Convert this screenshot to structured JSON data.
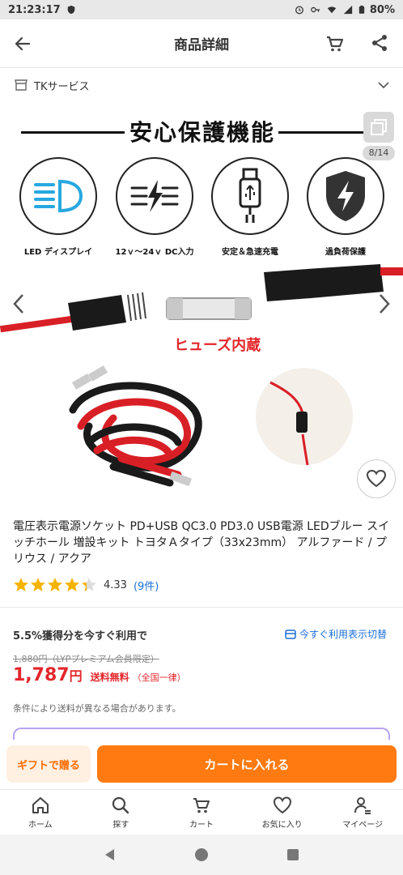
{
  "status": {
    "time": "21:23:17",
    "battery": "80%"
  },
  "header": {
    "title": "商品詳細"
  },
  "store": {
    "name": "TKサービス"
  },
  "gallery": {
    "heading": "安心保護機能",
    "features": [
      {
        "label": "LED ディスプレイ",
        "icon": "led-headlight-icon"
      },
      {
        "label": "12ｖ～24ｖ DC入力",
        "icon": "voltage-icon"
      },
      {
        "label": "安定＆急速充電",
        "icon": "usb-plug-icon"
      },
      {
        "label": "過負荷保護",
        "icon": "shield-bolt-icon"
      }
    ],
    "fuse_caption": "ヒューズ内蔵",
    "counter": "8/14"
  },
  "product": {
    "title": "電圧表示電源ソケット PD+USB QC3.0 PD3.0 USB電源 LEDブルー スイッチホール 増設キット トヨタＡタイプ（33x23mm） アルファード / プリウス / アクア",
    "rating": "4.33",
    "rating_fraction": 0.866,
    "reviews": "(9件)"
  },
  "pricing": {
    "promo": "5.5%獲得分を今すぐ利用で",
    "promo_link": "今すぐ利用表示切替",
    "old_price": "1,880円（LYPプレミアム会員限定）",
    "price": "1,787",
    "yen": "円",
    "shipping": "送料無料",
    "shipping_note": "（全国一律）",
    "note": "条件により送料が異なる場合があります。"
  },
  "actions": {
    "gift": "ギフトで贈る",
    "cart": "カートに入れる"
  },
  "tabs": [
    {
      "label": "ホーム",
      "icon": "home-icon"
    },
    {
      "label": "探す",
      "icon": "search-icon"
    },
    {
      "label": "カート",
      "icon": "cart-icon"
    },
    {
      "label": "お気に入り",
      "icon": "heart-icon"
    },
    {
      "label": "マイページ",
      "icon": "person-icon"
    }
  ],
  "colors": {
    "accent": "#ff7a10",
    "price": "#e3262b",
    "link": "#1a6ed8"
  }
}
